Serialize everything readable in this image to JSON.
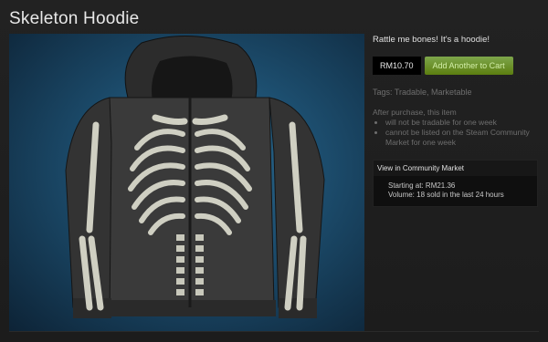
{
  "item": {
    "title": "Skeleton Hoodie",
    "description": "Rattle me bones! It's a hoodie!",
    "image_alt": "skeleton-hoodie-image"
  },
  "purchase": {
    "price": "RM10.70",
    "add_to_cart_label": "Add Another to Cart",
    "button_color": "#6f9a2c"
  },
  "tags": "Tags: Tradable, Marketable",
  "notice": {
    "intro": "After purchase, this item",
    "points": [
      "will not be tradable for one week",
      "cannot be listed on the Steam Community Market for one week"
    ]
  },
  "market": {
    "header": "View in Community Market",
    "starting_at": "Starting at: RM21.36",
    "volume": "Volume: 18 sold in the last 24 hours"
  }
}
